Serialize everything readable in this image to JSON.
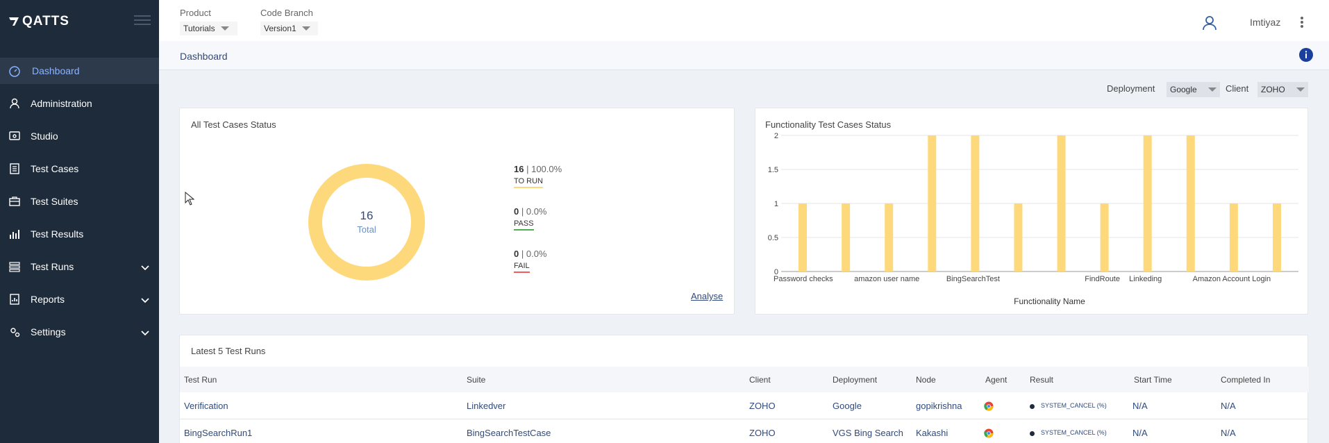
{
  "app": {
    "logo_text": "QATTS"
  },
  "sidebar": {
    "items": [
      {
        "label": "Dashboard"
      },
      {
        "label": "Administration"
      },
      {
        "label": "Studio"
      },
      {
        "label": "Test Cases"
      },
      {
        "label": "Test Suites"
      },
      {
        "label": "Test Results"
      },
      {
        "label": "Test Runs"
      },
      {
        "label": "Reports"
      },
      {
        "label": "Settings"
      }
    ]
  },
  "header": {
    "product_label": "Product",
    "product_value": "Tutorials",
    "branch_label": "Code Branch",
    "branch_value": "Version1",
    "user_name": "Imtiyaz"
  },
  "breadcrumb": {
    "title": "Dashboard"
  },
  "filters": {
    "deployment_label": "Deployment",
    "deployment_value": "Google",
    "client_label": "Client",
    "client_value": "ZOHO"
  },
  "status_card": {
    "title": "All Test Cases Status",
    "total_value": "16",
    "total_label": "Total",
    "to_run_count": "16",
    "to_run_pct": "| 100.0%",
    "to_run_label": "TO RUN",
    "pass_count": "0",
    "pass_pct": "| 0.0%",
    "pass_label": "PASS",
    "fail_count": "0",
    "fail_pct": "| 0.0%",
    "fail_label": "FAIL",
    "analyse_link": "Analyse"
  },
  "chart_data": {
    "type": "bar",
    "title": "Functionality Test Cases Status",
    "xlabel": "Functionality Name",
    "ylabel": "",
    "ylim": [
      0,
      2
    ],
    "yticks": [
      "0",
      "0.5",
      "1",
      "1.5",
      "2"
    ],
    "categories": [
      "Password checks",
      "",
      "amazon user name",
      "",
      "BingSearchTest",
      "",
      "",
      "FindRoute",
      "Linkeding",
      "",
      "Amazon Account Login",
      ""
    ],
    "values": [
      1,
      1,
      1,
      2,
      2,
      1,
      2,
      1,
      2,
      2,
      1,
      1
    ],
    "x_tick_labels": [
      "Password checks",
      "amazon user name",
      "BingSearchTest",
      "FindRoute",
      "Linkeding",
      "Amazon Account Login"
    ],
    "bar_color": "#fdd97c",
    "grid": true
  },
  "runs": {
    "title": "Latest 5 Test Runs",
    "columns": [
      "Test Run",
      "Suite",
      "Client",
      "Deployment",
      "Node",
      "Agent",
      "Result",
      "Start Time",
      "Completed In"
    ],
    "rows": [
      {
        "run": "Verification",
        "suite": "Linkedver",
        "client": "ZOHO",
        "deployment": "Google",
        "node": "gopikrishna",
        "result": "SYSTEM_CANCEL (%)",
        "start": "N/A",
        "completed": "N/A"
      },
      {
        "run": "BingSearchRun1",
        "suite": "BingSearchTestCase",
        "client": "ZOHO",
        "deployment": "VGS Bing Search",
        "node": "Kakashi",
        "result": "SYSTEM_CANCEL (%)",
        "start": "N/A",
        "completed": "N/A"
      }
    ]
  },
  "colors": {
    "sidebar_bg": "#1e2b3a",
    "accent": "#8ab4ff",
    "donut": "#fdd97c",
    "pass": "#4caf50",
    "fail": "#f15b5b"
  }
}
